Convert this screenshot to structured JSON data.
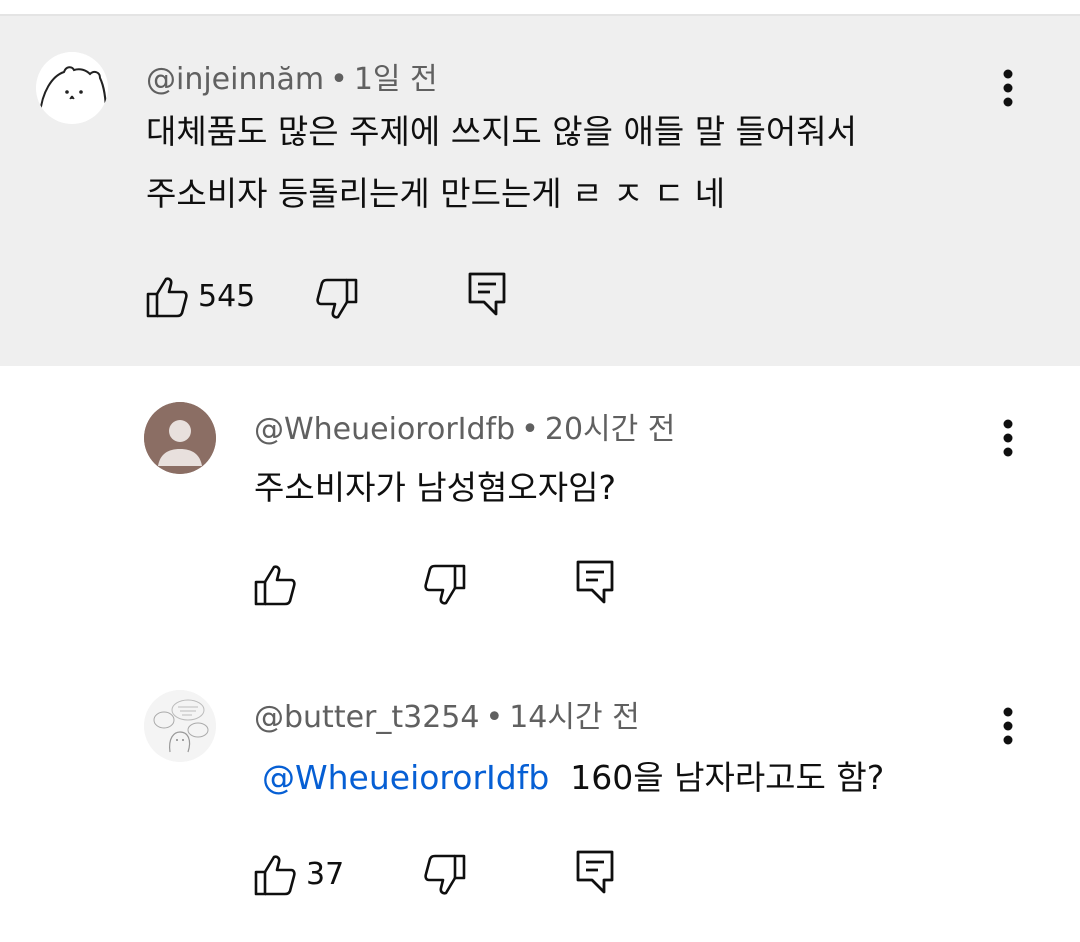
{
  "comments": [
    {
      "handle": "@injeinnăm",
      "time": "1일 전",
      "lines": [
        "대체품도 많은 주제에 쓰지도 않을 애들 말 들어줘서",
        "주소비자 등돌리는게 만드는게 ㄹ ㅈ ㄷ 네"
      ],
      "likes": "545",
      "highlighted": true,
      "avatar_icon": "bear-face-icon"
    },
    {
      "handle": "@WheueiororIdfb",
      "time": "20시간 전",
      "lines": [
        "주소비자가 남성혐오자임?"
      ],
      "likes": "",
      "avatar_icon": "default-user-icon"
    },
    {
      "handle": "@butter_t3254",
      "time": "14시간 전",
      "mention": "@WheueiororIdfb",
      "text_after_mention": "160을 남자라고도 함?",
      "likes": "37",
      "avatar_icon": "doodle-avatar-icon"
    }
  ],
  "colors": {
    "highlight_bg": "#efefef",
    "mention": "#065fd4",
    "meta": "#606060"
  }
}
